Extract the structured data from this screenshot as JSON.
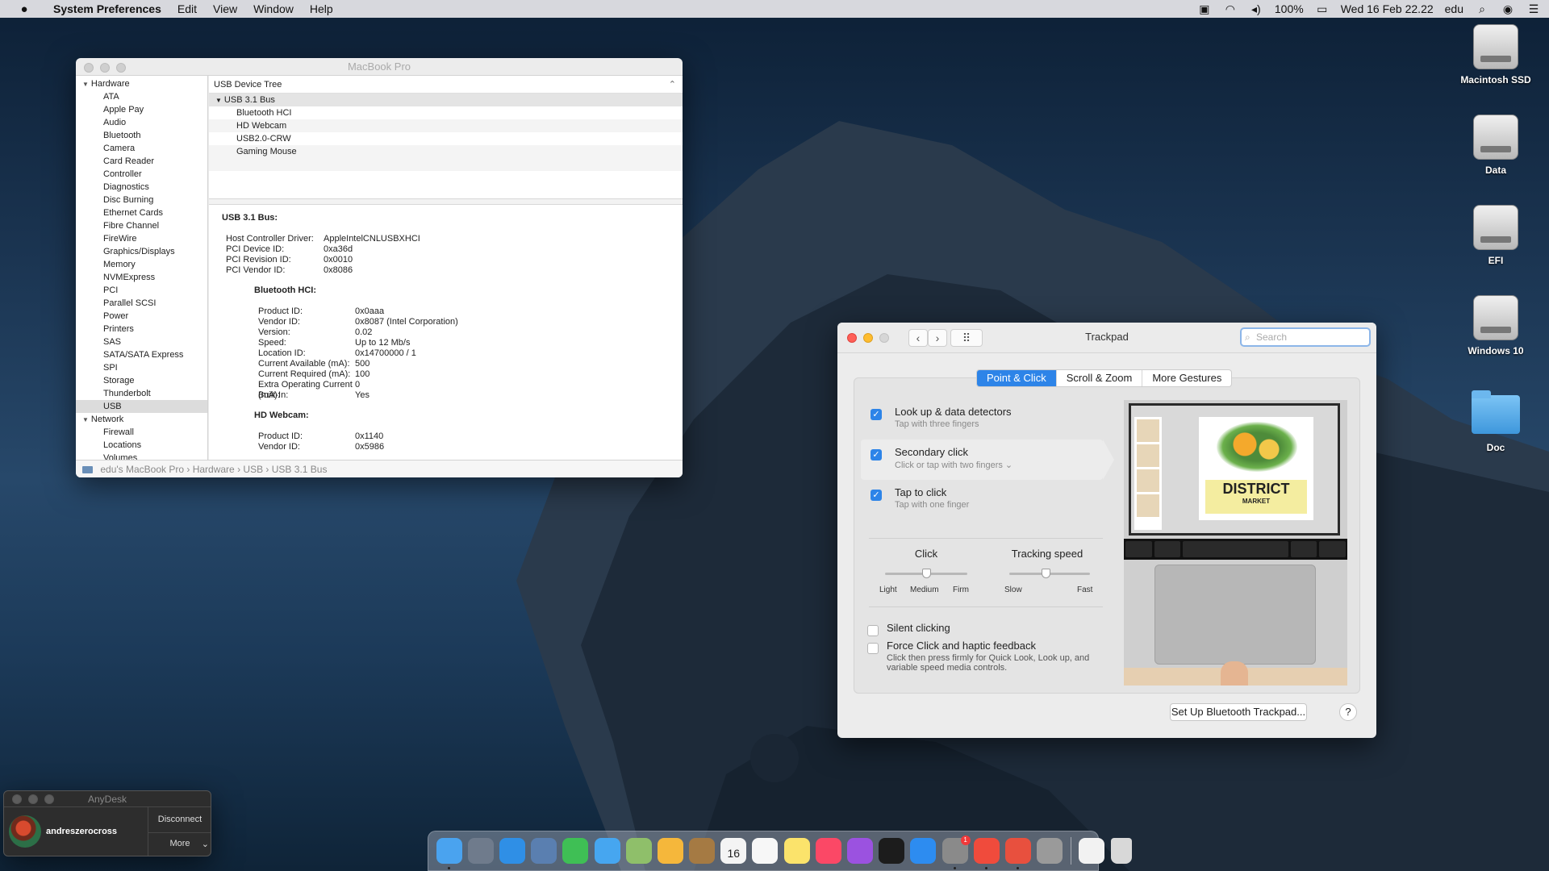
{
  "menubar": {
    "app_name": "System Preferences",
    "menus": [
      "Edit",
      "View",
      "Window",
      "Help"
    ],
    "battery": "100%",
    "datetime": "Wed 16 Feb  22.22",
    "user": "edu"
  },
  "desktop_icons": [
    {
      "label": "Macintosh SSD",
      "icon": "hard-drive-icon"
    },
    {
      "label": "Data",
      "icon": "hard-drive-icon"
    },
    {
      "label": "EFI",
      "icon": "hard-drive-icon"
    },
    {
      "label": "Windows 10",
      "icon": "hard-drive-icon"
    },
    {
      "label": "Doc",
      "icon": "folder-icon"
    }
  ],
  "sysinfo": {
    "title": "MacBook Pro",
    "sidebar": {
      "hardware_label": "Hardware",
      "hardware_items": [
        "ATA",
        "Apple Pay",
        "Audio",
        "Bluetooth",
        "Camera",
        "Card Reader",
        "Controller",
        "Diagnostics",
        "Disc Burning",
        "Ethernet Cards",
        "Fibre Channel",
        "FireWire",
        "Graphics/Displays",
        "Memory",
        "NVMExpress",
        "PCI",
        "Parallel SCSI",
        "Power",
        "Printers",
        "SAS",
        "SATA/SATA Express",
        "SPI",
        "Storage",
        "Thunderbolt",
        "USB"
      ],
      "selected": "USB",
      "network_label": "Network",
      "network_items": [
        "Firewall",
        "Locations",
        "Volumes"
      ]
    },
    "tree": {
      "header": "USB Device Tree",
      "bus": "USB 3.1 Bus",
      "devices": [
        "Bluetooth HCI",
        "HD Webcam",
        "USB2.0-CRW",
        "Gaming Mouse"
      ]
    },
    "detail": {
      "heading": "USB 3.1 Bus:",
      "bus_props": [
        {
          "k": "Host Controller Driver:",
          "v": "AppleIntelCNLUSBXHCI"
        },
        {
          "k": "PCI Device ID:",
          "v": "0xa36d"
        },
        {
          "k": "PCI Revision ID:",
          "v": "0x0010"
        },
        {
          "k": "PCI Vendor ID:",
          "v": "0x8086"
        }
      ],
      "bt_heading": "Bluetooth HCI:",
      "bt_props": [
        {
          "k": "Product ID:",
          "v": "0x0aaa"
        },
        {
          "k": "Vendor ID:",
          "v": "0x8087  (Intel Corporation)"
        },
        {
          "k": "Version:",
          "v": "0.02"
        },
        {
          "k": "Speed:",
          "v": "Up to 12 Mb/s"
        },
        {
          "k": "Location ID:",
          "v": "0x14700000 / 1"
        },
        {
          "k": "Current Available (mA):",
          "v": "500"
        },
        {
          "k": "Current Required (mA):",
          "v": "100"
        },
        {
          "k": "Extra Operating Current (mA):",
          "v": "0"
        },
        {
          "k": "Built-In:",
          "v": "Yes"
        }
      ],
      "cam_heading": "HD Webcam:",
      "cam_props": [
        {
          "k": "Product ID:",
          "v": "0x1140"
        },
        {
          "k": "Vendor ID:",
          "v": "0x5986"
        }
      ]
    },
    "path": [
      "edu's MacBook Pro",
      "Hardware",
      "USB",
      "USB 3.1 Bus"
    ]
  },
  "trackpad": {
    "title": "Trackpad",
    "search_placeholder": "Search",
    "tabs": [
      "Point & Click",
      "Scroll & Zoom",
      "More Gestures"
    ],
    "options": [
      {
        "label": "Look up & data detectors",
        "hint": "Tap with three fingers",
        "checked": true
      },
      {
        "label": "Secondary click",
        "hint": "Click or tap with two fingers ⌄",
        "checked": true
      },
      {
        "label": "Tap to click",
        "hint": "Tap with one finger",
        "checked": true
      }
    ],
    "click": {
      "label": "Click",
      "ticks": [
        "Light",
        "Medium",
        "Firm"
      ],
      "value_fraction": 0.5
    },
    "tracking": {
      "label": "Tracking speed",
      "ticks": [
        "Slow",
        "Fast"
      ],
      "value_fraction": 0.45
    },
    "silent_clicking": {
      "label": "Silent clicking",
      "checked": false
    },
    "force_click": {
      "label": "Force Click and haptic feedback",
      "hint": "Click then press firmly for Quick Look, Look up, and variable speed media controls.",
      "checked": false
    },
    "preview": {
      "brand": "DISTRICT",
      "brand_sub": "MARKET"
    },
    "setup_button": "Set Up Bluetooth Trackpad...",
    "help_button": "?"
  },
  "anydesk": {
    "title": "AnyDesk",
    "user": "andreszerocross",
    "disconnect": "Disconnect",
    "more": "More"
  },
  "dock": {
    "calendar_day": "16",
    "settings_badge": "1",
    "colors": [
      "#4aa3ef",
      "#6f7b8c",
      "#2f8fe6",
      "#5a7fb0",
      "#3fbf55",
      "#46a6f0",
      "#8fbf6a",
      "#f5b73b",
      "#a57a43",
      "#f4f4f4",
      "#f7f7f7",
      "#fbe36b",
      "#fb4866",
      "#9b52e0",
      "#1c1c1c",
      "#2d8cf0",
      "#8a8a8a",
      "#f04b3c",
      "#e8503e",
      "#9a9a9a",
      "#f2f2f2",
      "#d8d8d8"
    ]
  }
}
